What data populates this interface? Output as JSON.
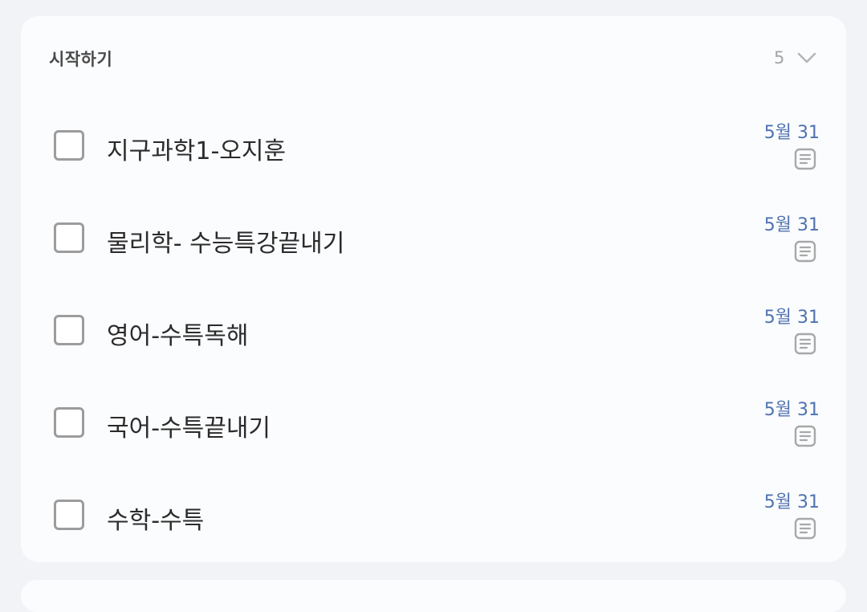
{
  "section": {
    "title": "시작하기",
    "count": "5",
    "toggle_icon": "chevron-down-icon"
  },
  "tasks": [
    {
      "title": "지구과학1-오지훈",
      "date": "5월 31",
      "note_icon": "note-icon",
      "checked": false
    },
    {
      "title": "물리학- 수능특강끝내기",
      "date": "5월 31",
      "note_icon": "note-icon",
      "checked": false
    },
    {
      "title": "영어-수특독해",
      "date": "5월 31",
      "note_icon": "note-icon",
      "checked": false
    },
    {
      "title": "국어-수특끝내기",
      "date": "5월 31",
      "note_icon": "note-icon",
      "checked": false
    },
    {
      "title": "수학-수특",
      "date": "5월 31",
      "note_icon": "note-icon",
      "checked": false
    }
  ],
  "colors": {
    "background": "#f2f3f7",
    "card": "#fbfcfe",
    "date_accent": "#4f72b0",
    "checkbox_border": "#9c9c9c",
    "muted": "#a4a4a4"
  }
}
